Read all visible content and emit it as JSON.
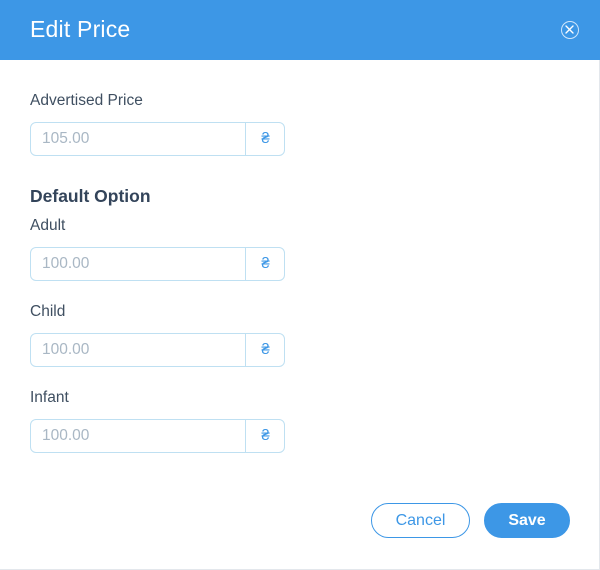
{
  "dialog": {
    "title": "Edit Price"
  },
  "advertised_price": {
    "label": "Advertised Price",
    "placeholder": "105.00",
    "currency": "₴"
  },
  "default_option": {
    "title": "Default Option",
    "fields": [
      {
        "label": "Adult",
        "placeholder": "100.00",
        "currency": "₴"
      },
      {
        "label": "Child",
        "placeholder": "100.00",
        "currency": "₴"
      },
      {
        "label": "Infant",
        "placeholder": "100.00",
        "currency": "₴"
      }
    ]
  },
  "footer": {
    "cancel_label": "Cancel",
    "save_label": "Save"
  },
  "colors": {
    "accent": "#3d97e6",
    "input_border": "#bfe0f2",
    "text": "#3f4f61",
    "placeholder": "#a9b7c4"
  }
}
